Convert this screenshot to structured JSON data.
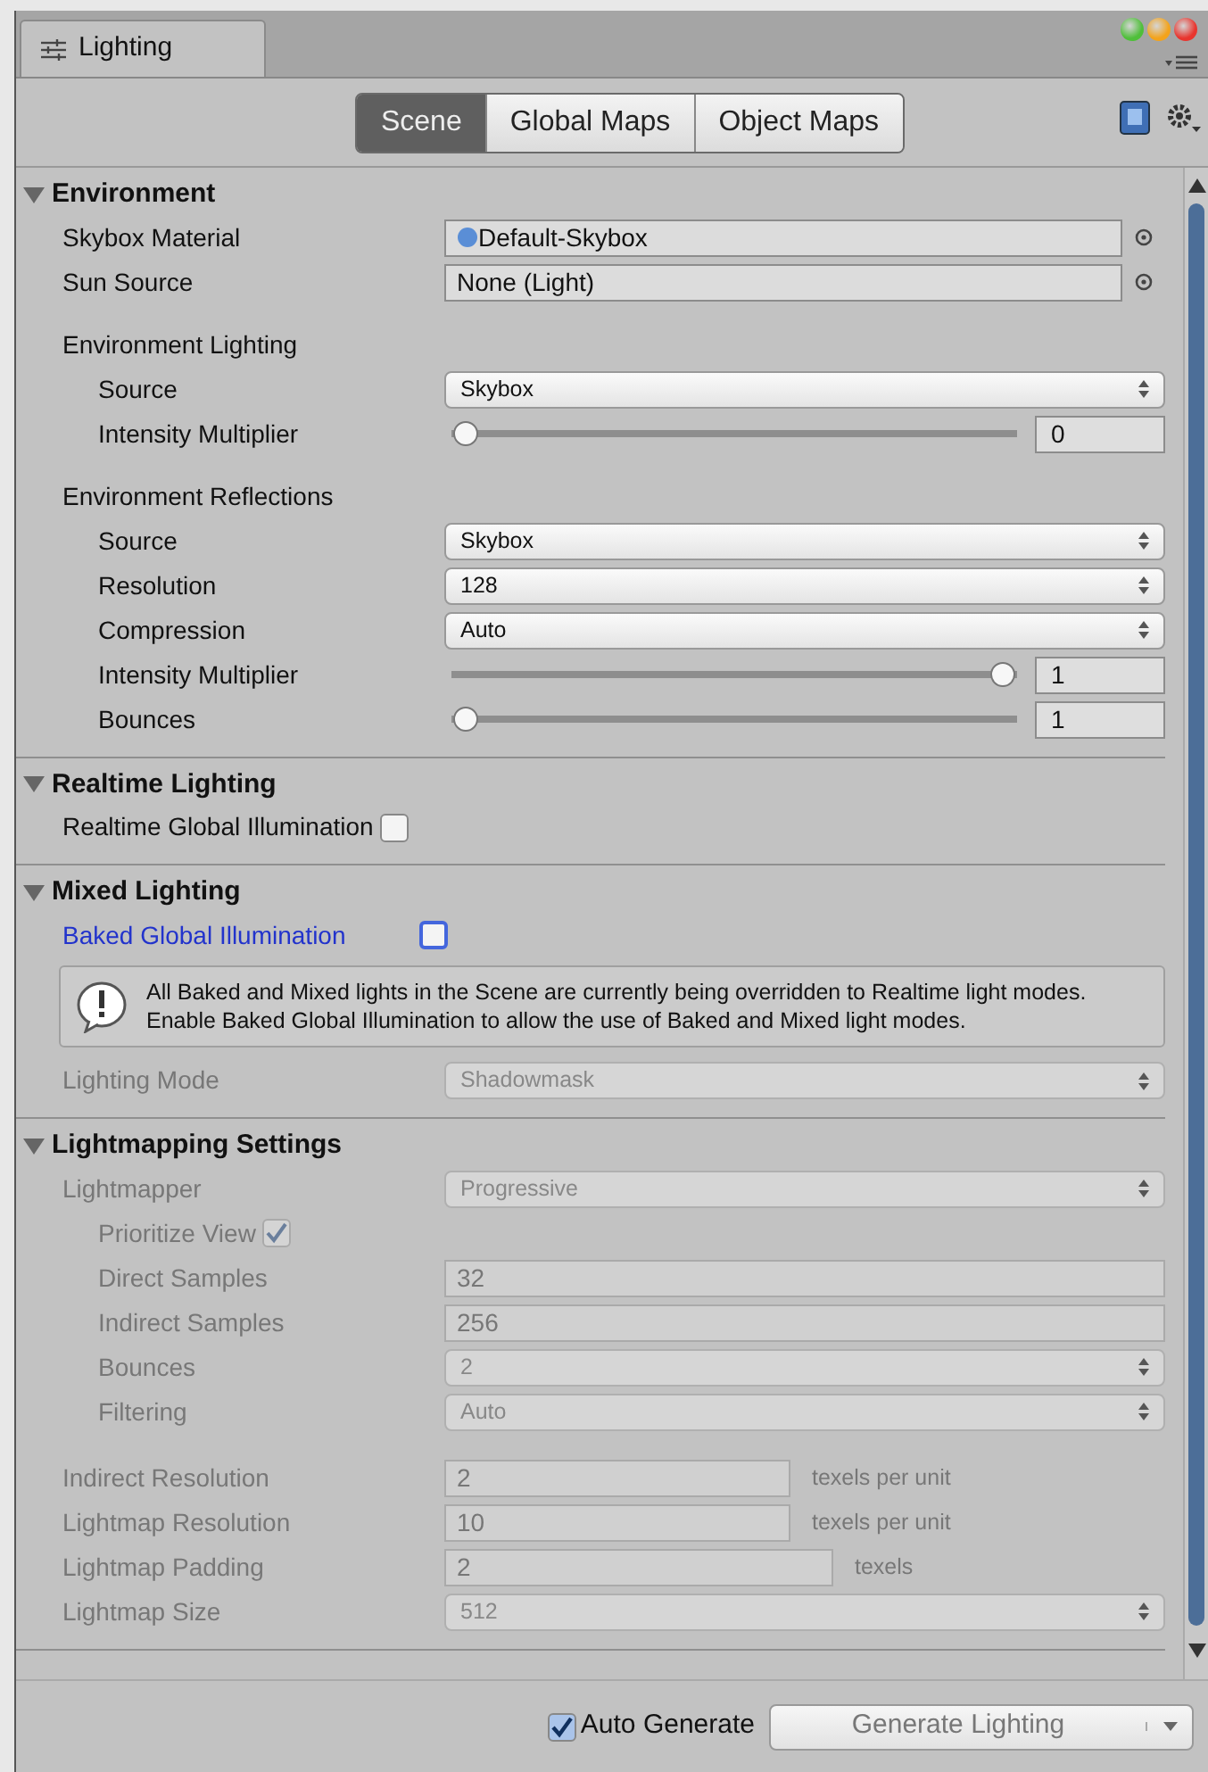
{
  "window": {
    "title": "Lighting"
  },
  "tabs": [
    {
      "label": "Scene",
      "selected": true
    },
    {
      "label": "Global Maps",
      "selected": false
    },
    {
      "label": "Object Maps",
      "selected": false
    }
  ],
  "sections": [
    {
      "title": "Environment",
      "expanded": true,
      "rows": [
        {
          "kind": "object",
          "label": "Skybox Material",
          "value": "Default-Skybox",
          "disabled": false
        },
        {
          "kind": "object",
          "label": "Sun Source",
          "value": "None (Light)",
          "disabled": false
        },
        {
          "kind": "heading",
          "label": "Environment Lighting",
          "disabled": false,
          "children": [
            {
              "kind": "select",
              "label": "Source",
              "value": "Skybox",
              "disabled": false
            },
            {
              "kind": "slider",
              "label": "Intensity Multiplier",
              "level": 0,
              "reading": "0",
              "disabled": false
            }
          ]
        },
        {
          "kind": "heading",
          "label": "Environment Reflections",
          "disabled": false,
          "children": [
            {
              "kind": "select",
              "label": "Source",
              "value": "Skybox",
              "disabled": false
            },
            {
              "kind": "select",
              "label": "Resolution",
              "value": "128",
              "disabled": false
            },
            {
              "kind": "select",
              "label": "Compression",
              "value": "Auto",
              "disabled": false
            },
            {
              "kind": "slider",
              "label": "Intensity Multiplier",
              "level": 1,
              "reading": "1",
              "disabled": false
            },
            {
              "kind": "slider",
              "label": "Bounces",
              "level": 0,
              "reading": "1",
              "disabled": false
            }
          ]
        }
      ]
    },
    {
      "title": "Realtime Lighting",
      "expanded": true,
      "rows": [
        {
          "kind": "checkbox",
          "label": "Realtime Global Illumination",
          "checked": false,
          "highlighted": false,
          "disabled": false
        }
      ]
    },
    {
      "title": "Mixed Lighting",
      "expanded": true,
      "rows": [
        {
          "kind": "checkbox",
          "label": "Baked Global Illumination",
          "checked": false,
          "highlighted": true,
          "disabled": false
        },
        {
          "kind": "help",
          "text": "All Baked and Mixed lights in the Scene are currently being overridden to Realtime light modes. Enable Baked Global Illumination to allow the use of Baked and Mixed light modes.",
          "disabled": false
        },
        {
          "kind": "select",
          "label": "Lighting Mode",
          "value": "Shadowmask",
          "disabled": true
        }
      ]
    },
    {
      "title": "Lightmapping Settings",
      "expanded": true,
      "rows": [
        {
          "kind": "select",
          "label": "Lightmapper",
          "value": "Progressive",
          "disabled": true,
          "children": [
            {
              "kind": "checkbox",
              "label": "Prioritize View",
              "checked": true,
              "highlighted": false,
              "disabled": true
            },
            {
              "kind": "text",
              "label": "Direct Samples",
              "value": "32",
              "disabled": true
            },
            {
              "kind": "text",
              "label": "Indirect Samples",
              "value": "256",
              "disabled": true
            },
            {
              "kind": "select",
              "label": "Bounces",
              "value": "2",
              "disabled": true
            },
            {
              "kind": "select",
              "label": "Filtering",
              "value": "Auto",
              "disabled": true
            }
          ]
        },
        {
          "kind": "text",
          "label": "Indirect Resolution",
          "value": "2",
          "suffix": "texels per unit",
          "disabled": true
        },
        {
          "kind": "text",
          "label": "Lightmap Resolution",
          "value": "10",
          "suffix": "texels per unit",
          "disabled": true
        },
        {
          "kind": "text",
          "label": "Lightmap Padding",
          "value": "2",
          "suffix": "texels",
          "disabled": true
        },
        {
          "kind": "select",
          "label": "Lightmap Size",
          "value": "512",
          "disabled": true
        }
      ]
    }
  ],
  "footer": {
    "auto_generate": {
      "label": "Auto Generate",
      "checked": true
    },
    "generate_button": {
      "label": "Generate Lighting"
    }
  }
}
